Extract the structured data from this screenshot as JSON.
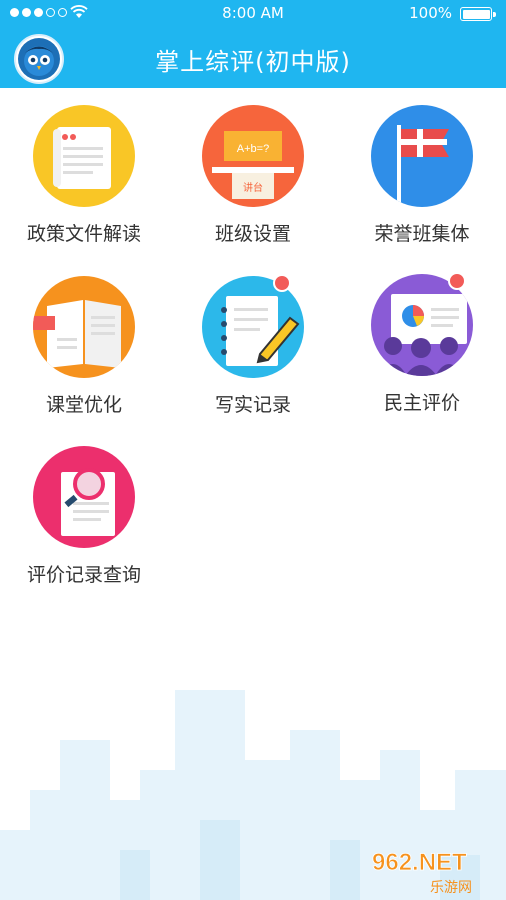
{
  "status_bar": {
    "time": "8:00 AM",
    "battery": "100%",
    "battery_level": 1.0
  },
  "header": {
    "title": "掌上综评(初中版)",
    "accent_color": "#1fb6f0"
  },
  "menu": {
    "items": [
      {
        "label": "政策文件解读",
        "icon": "policy-document-icon",
        "color": "#f9c626",
        "badge": false
      },
      {
        "label": "班级设置",
        "icon": "classroom-podium-icon",
        "color": "#f6653c",
        "badge": false,
        "board_text": "A+b=?",
        "podium_text": "讲台"
      },
      {
        "label": "荣誉班集体",
        "icon": "honor-flag-icon",
        "color": "#2f8ee8",
        "badge": false
      },
      {
        "label": "课堂优化",
        "icon": "open-book-icon",
        "color": "#f6921e",
        "badge": false
      },
      {
        "label": "写实记录",
        "icon": "notebook-pencil-icon",
        "color": "#2cb8ea",
        "badge": true
      },
      {
        "label": "民主评价",
        "icon": "presentation-audience-icon",
        "color": "#8a5bd6",
        "badge": true
      },
      {
        "label": "评价记录查询",
        "icon": "magnifier-document-icon",
        "color": "#ec2f6d",
        "badge": false
      }
    ]
  },
  "watermark": {
    "brand": "962.NET",
    "sub": "乐游网"
  }
}
